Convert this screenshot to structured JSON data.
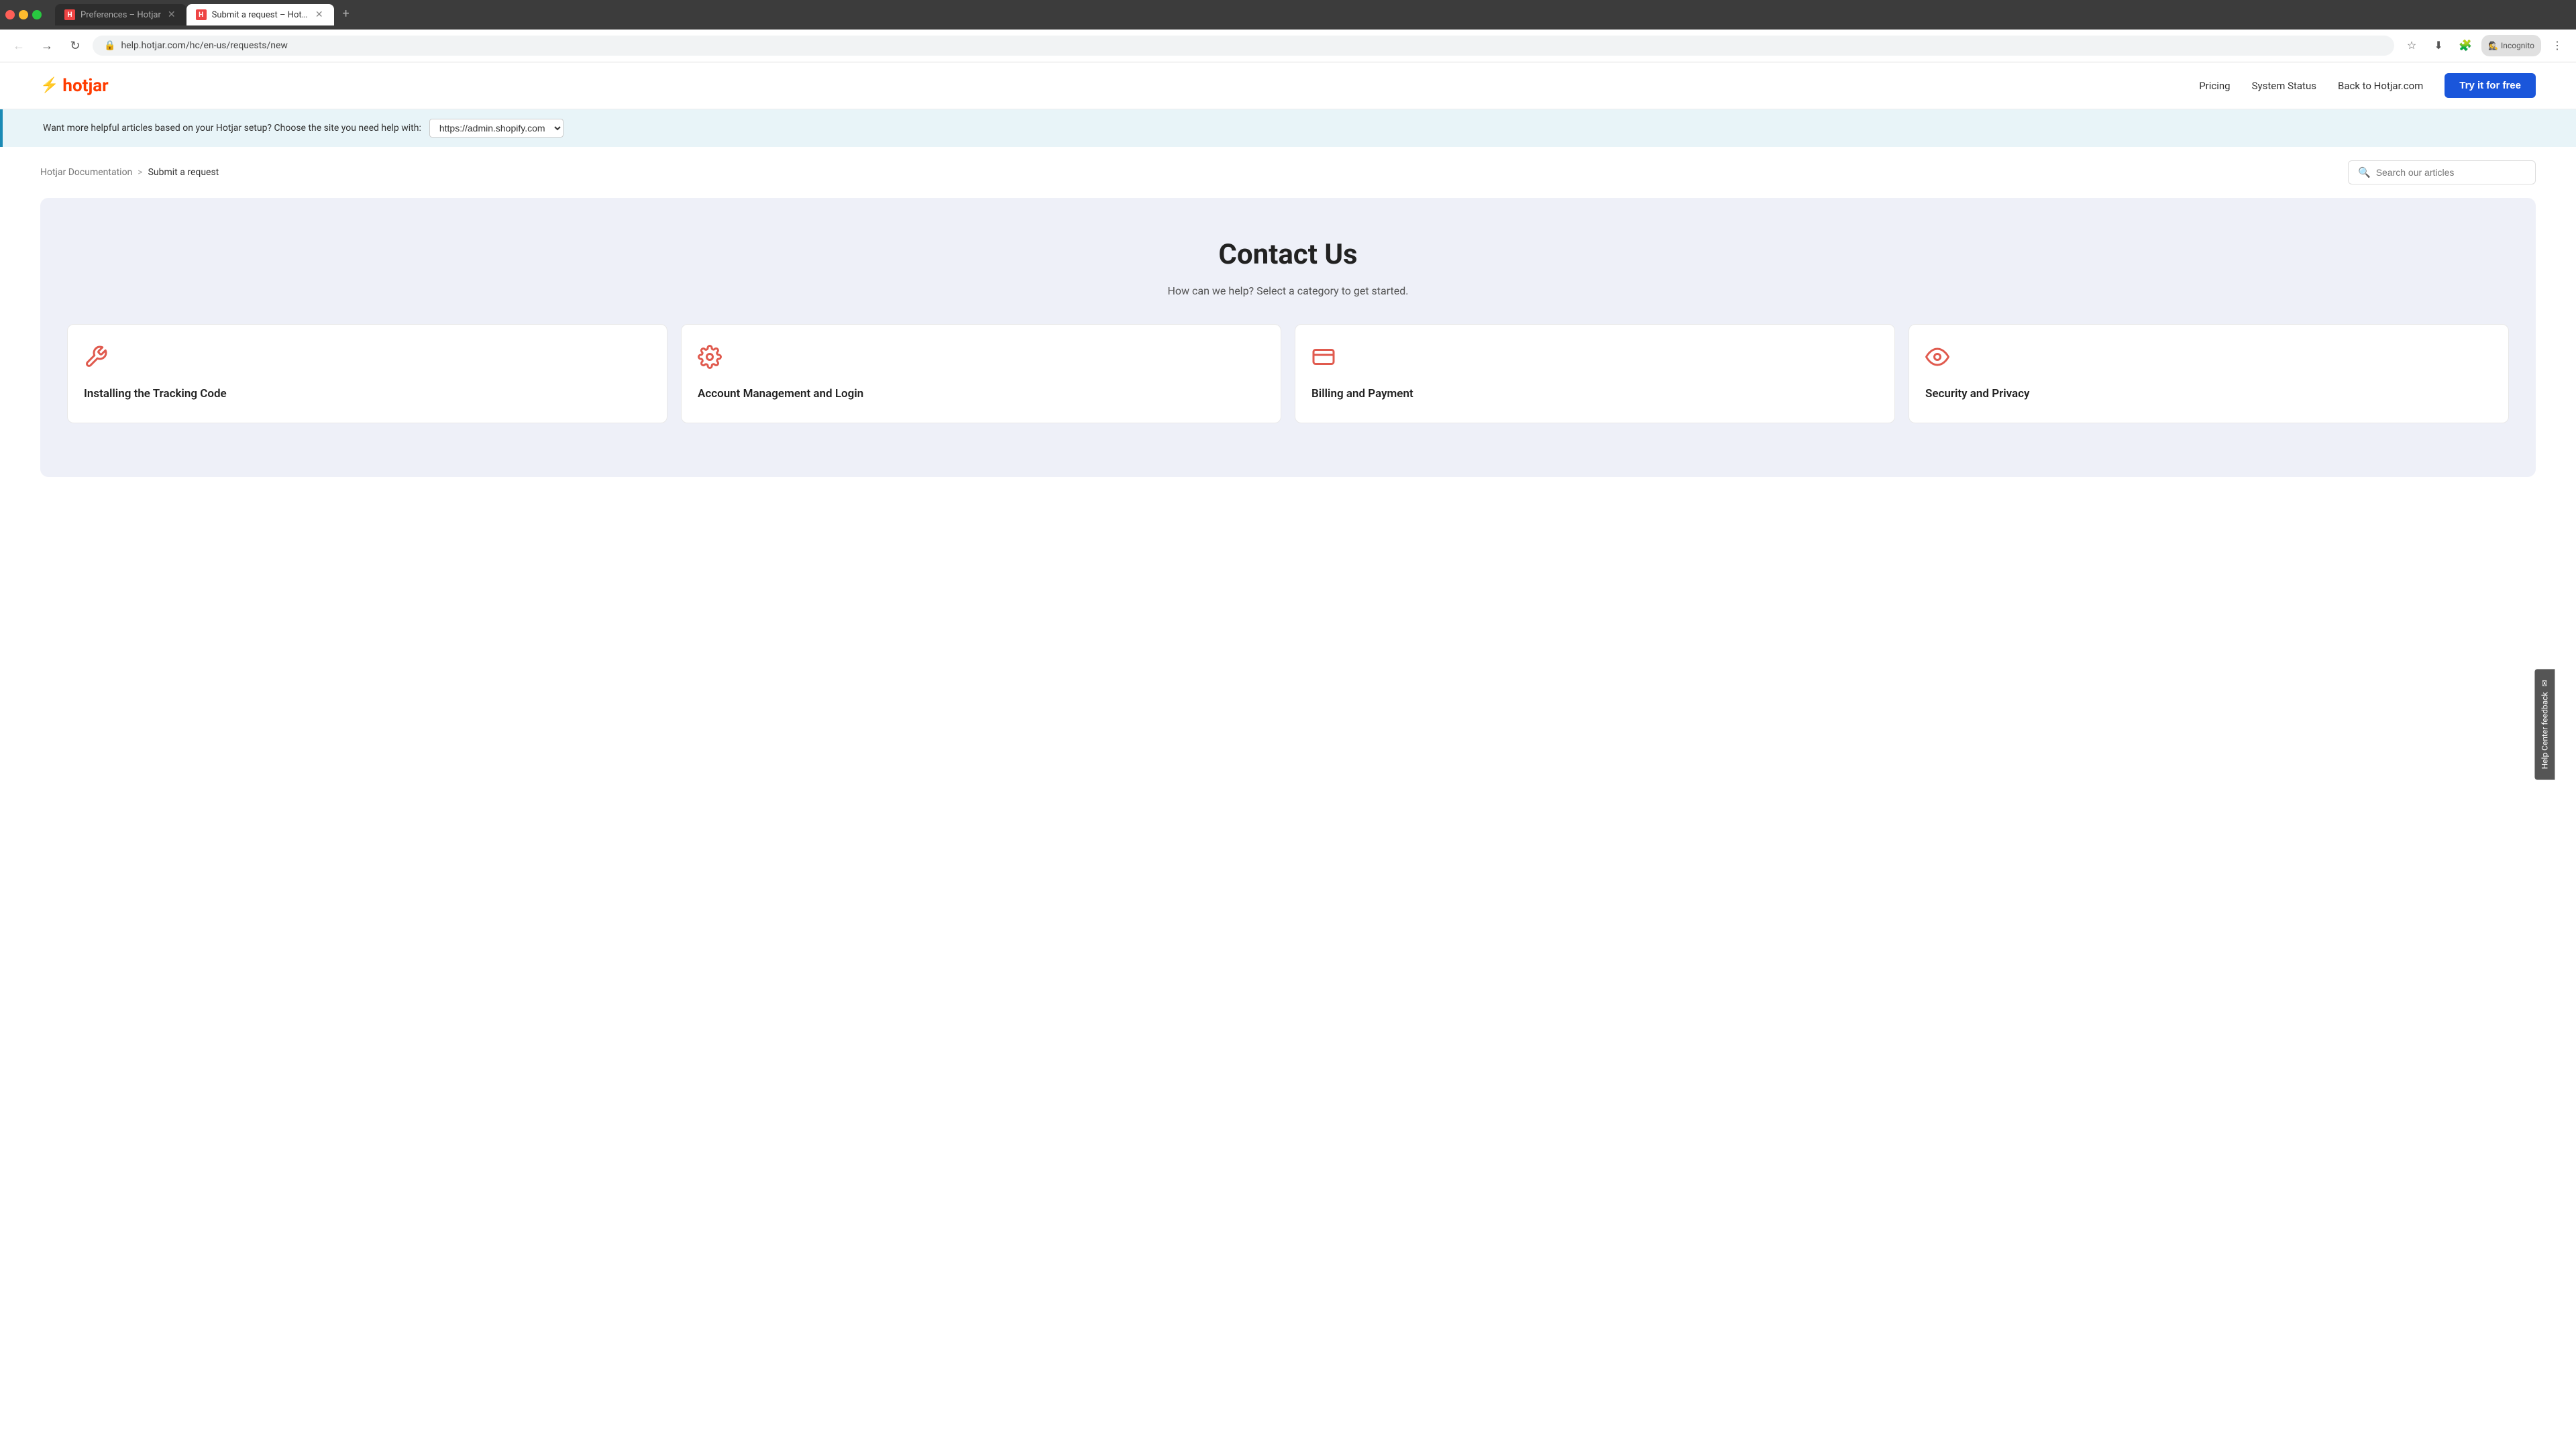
{
  "browser": {
    "tabs": [
      {
        "id": "tab-1",
        "title": "Preferences – Hotjar",
        "favicon": "H",
        "active": false,
        "url": ""
      },
      {
        "id": "tab-2",
        "title": "Submit a request – Hotjar Docu...",
        "favicon": "H",
        "active": true,
        "url": "help.hotjar.com/hc/en-us/requests/new"
      }
    ],
    "new_tab_label": "+",
    "nav_back": "←",
    "nav_forward": "→",
    "nav_refresh": "↻",
    "address": "help.hotjar.com/hc/en-us/requests/new",
    "incognito_label": "Incognito"
  },
  "site_nav": {
    "logo_text": "hotjar",
    "links": [
      {
        "label": "Pricing",
        "id": "pricing-link"
      },
      {
        "label": "System Status",
        "id": "system-status-link"
      },
      {
        "label": "Back to Hotjar.com",
        "id": "back-to-hotjar-link"
      }
    ],
    "cta_button": "Try it for free"
  },
  "banner": {
    "message": "Want more helpful articles based on your Hotjar setup? Choose the site you need help with:",
    "site_value": "https://admin.shopify.com"
  },
  "breadcrumb": {
    "parent_label": "Hotjar Documentation",
    "separator": ">",
    "current_label": "Submit a request"
  },
  "search": {
    "placeholder": "Search our articles"
  },
  "main": {
    "title": "Contact Us",
    "subtitle": "How can we help? Select a category to get started.",
    "categories": [
      {
        "id": "cat-tracking",
        "icon": "wrench",
        "title": "Installing the Tracking Code"
      },
      {
        "id": "cat-account",
        "icon": "gear",
        "title": "Account Management and Login"
      },
      {
        "id": "cat-billing",
        "icon": "wallet",
        "title": "Billing and Payment"
      },
      {
        "id": "cat-security",
        "icon": "eye",
        "title": "Security and Privacy"
      }
    ]
  },
  "help_feedback": {
    "label": "Help Center feedback",
    "icon": "✉"
  }
}
